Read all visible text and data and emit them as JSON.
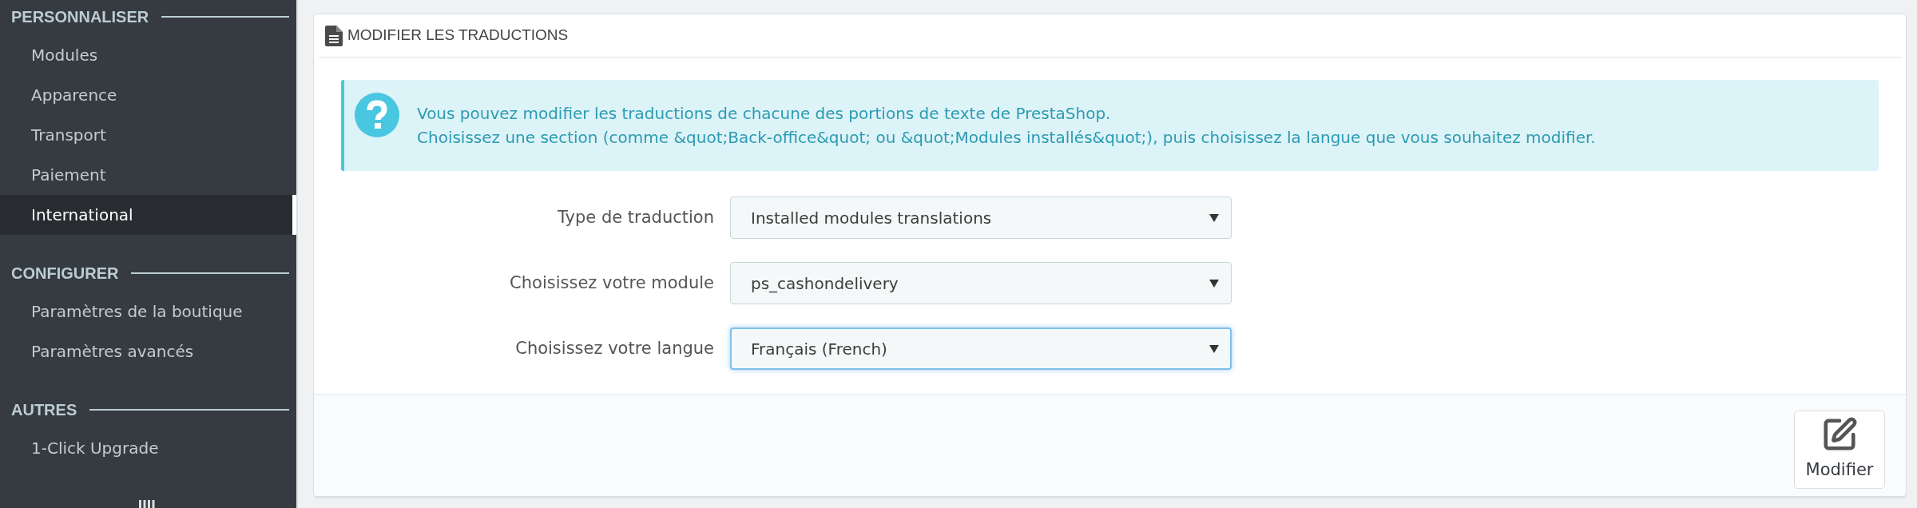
{
  "sidebar": {
    "sections": [
      {
        "title": "PERSONNALISER",
        "items": [
          {
            "label": "Modules",
            "selected": false
          },
          {
            "label": "Apparence",
            "selected": false
          },
          {
            "label": "Transport",
            "selected": false
          },
          {
            "label": "Paiement",
            "selected": false
          },
          {
            "label": "International",
            "selected": true
          }
        ]
      },
      {
        "title": "CONFIGURER",
        "items": [
          {
            "label": "Paramètres de la boutique",
            "selected": false
          },
          {
            "label": "Paramètres avancés",
            "selected": false
          }
        ]
      },
      {
        "title": "AUTRES",
        "items": [
          {
            "label": "1-Click Upgrade",
            "selected": false
          }
        ]
      }
    ]
  },
  "panel": {
    "title": "MODIFIER LES TRADUCTIONS",
    "info": {
      "lines": [
        "Vous pouvez modifier les traductions de chacune des portions de texte de PrestaShop.",
        "Choisissez une section (comme &quot;Back-office&quot; ou &quot;Modules installés&quot;), puis choisissez la langue que vous souhaitez modifier."
      ]
    },
    "fields": [
      {
        "label": "Type de traduction",
        "value": "Installed modules translations",
        "focused": false
      },
      {
        "label": "Choisissez votre module",
        "value": "ps_cashondelivery",
        "focused": false
      },
      {
        "label": "Choisissez votre langue",
        "value": "Français (French)",
        "focused": true
      }
    ],
    "submit": {
      "label": "Modifier"
    }
  }
}
